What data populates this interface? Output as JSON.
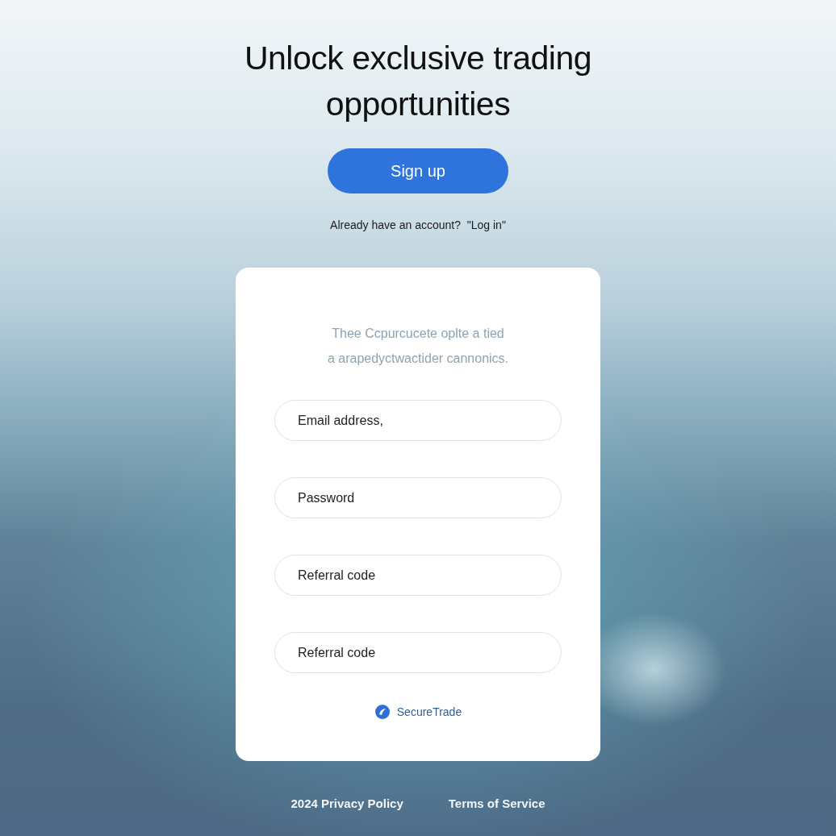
{
  "headline": "Unlock exclusive trading opportunities",
  "signup_button": "Sign up",
  "login_prompt": "Already have an account?  \"Log in\"",
  "card": {
    "description": "Thee Ccpurcucete oplte a tied\na arapedyctwactider cannonics.",
    "fields": [
      {
        "placeholder": "Email address,"
      },
      {
        "placeholder": "Password"
      },
      {
        "placeholder": "Referral code"
      },
      {
        "placeholder": "Referral code"
      }
    ],
    "brand": "SecureTrade"
  },
  "footer_links": [
    "2024 Privacy Policy",
    "Terms of Service"
  ]
}
